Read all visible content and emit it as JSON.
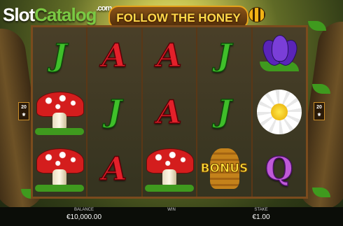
{
  "logo": {
    "part1": "Slot",
    "part2": "Catalog",
    "suffix": ".com"
  },
  "game": {
    "title": "FOLLOW THE HONEY"
  },
  "paylines": {
    "left": "20",
    "right": "20"
  },
  "reels": [
    [
      "J",
      "mushroom",
      "mushroom"
    ],
    [
      "A",
      "J",
      "A"
    ],
    [
      "A",
      "A",
      "mushroom"
    ],
    [
      "J",
      "J",
      "bonus"
    ],
    [
      "crocus",
      "daisy",
      "Q"
    ]
  ],
  "bonus_label": "BONUS",
  "footer": {
    "balance_label": "BALANCE",
    "balance_value": "€10,000.00",
    "win_label": "WIN",
    "win_value": "",
    "stake_label": "STAKE",
    "stake_value": "€1.00"
  },
  "colors": {
    "frame": "#5a3716",
    "title_text": "#ffd84a",
    "bar": "#0b0d08"
  }
}
